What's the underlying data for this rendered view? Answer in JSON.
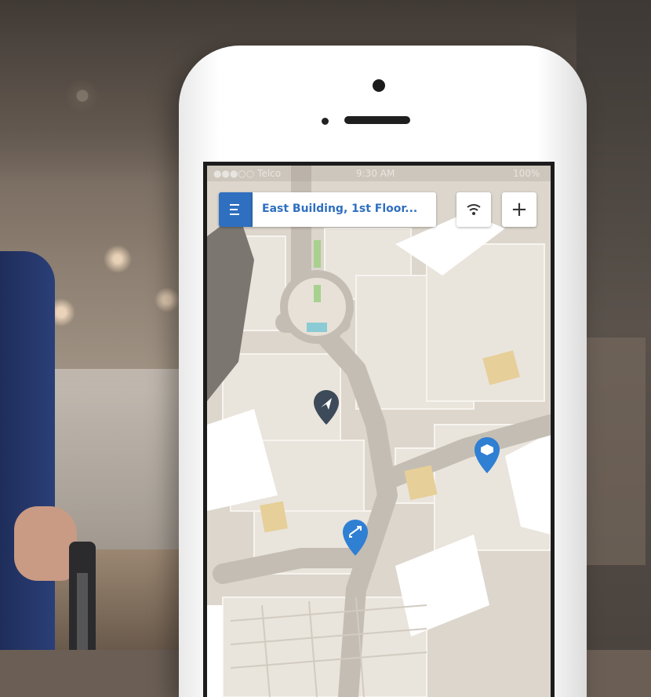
{
  "statusbar": {
    "carrier": "●●●○○ Telco",
    "time": "9:30 AM",
    "battery": "100%"
  },
  "header": {
    "menu_icon": "menu-icon",
    "location_title": "East Building, 1st Floor...",
    "wifi_icon": "wifi-icon",
    "zoom_in_label": "+"
  },
  "pins": [
    {
      "name": "current-location-pin",
      "icon": "navigation-arrow-icon",
      "color": "#3c4a5a"
    },
    {
      "name": "tag-pin",
      "icon": "tag-icon",
      "color": "#2f7fd3"
    },
    {
      "name": "transfer-pin",
      "icon": "swap-arrows-icon",
      "color": "#2f7fd3"
    }
  ],
  "colors": {
    "accent": "#2f6fbf",
    "map_background": "#dcd6cc",
    "walkway": "#c9c4bc"
  }
}
